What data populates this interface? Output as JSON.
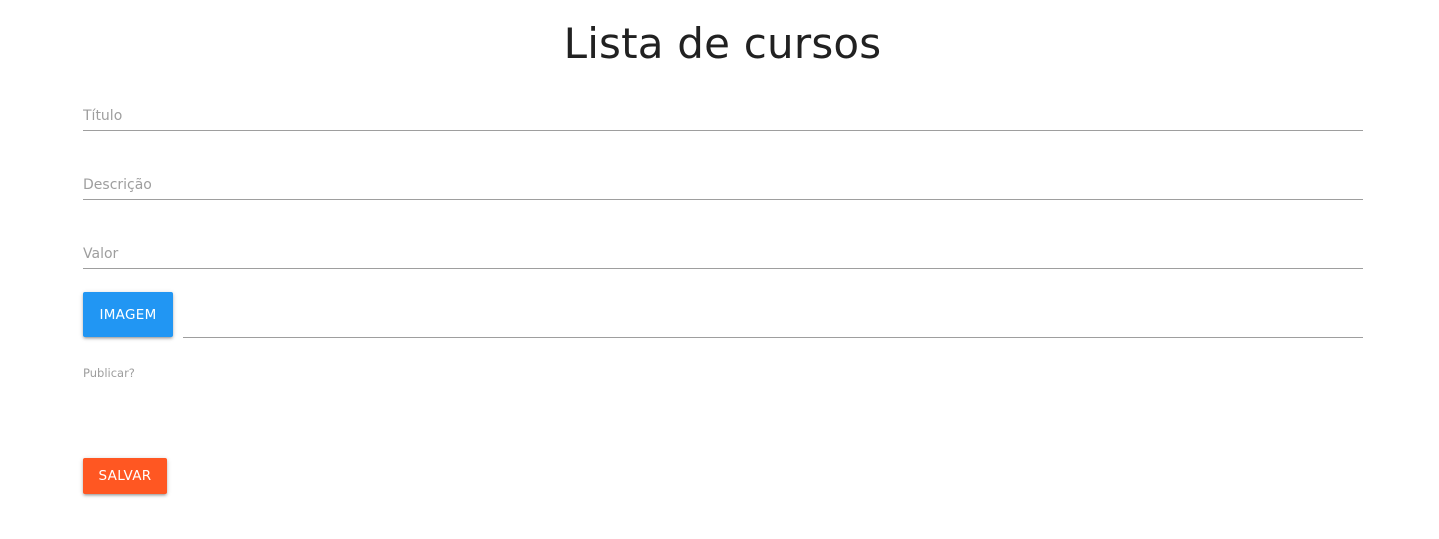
{
  "page": {
    "title": "Lista de cursos"
  },
  "form": {
    "titulo": {
      "placeholder": "Título",
      "value": ""
    },
    "descricao": {
      "placeholder": "Descrição",
      "value": ""
    },
    "valor": {
      "placeholder": "Valor",
      "value": ""
    },
    "imagem": {
      "button_label": "IMAGEM",
      "file_path": ""
    },
    "publicar": {
      "label": "Publicar?"
    },
    "salvar": {
      "button_label": "SALVAR"
    }
  },
  "colors": {
    "primary_button": "#2196f3",
    "accent_button": "#ff5722",
    "placeholder_text": "#9e9e9e",
    "underline": "#9e9e9e",
    "title_text": "#212121"
  }
}
